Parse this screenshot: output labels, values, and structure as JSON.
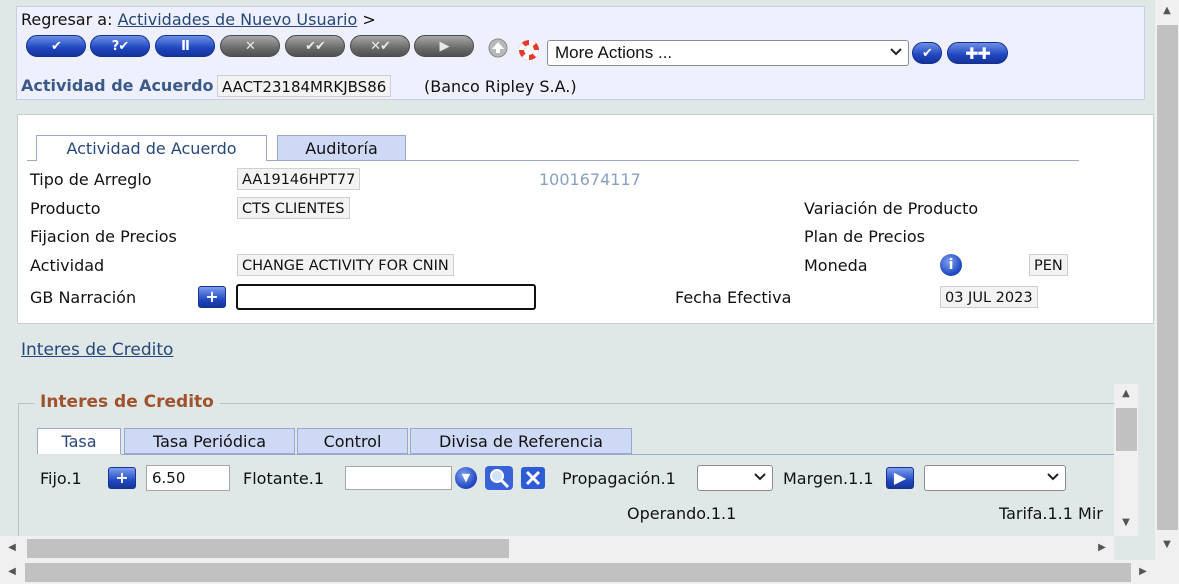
{
  "breadcrumb": {
    "prefix": "Regresar a:",
    "link": "Actividades de Nuevo Usuario",
    "separator": ">"
  },
  "toolbar": {
    "buttons": [
      {
        "name": "commit-button",
        "label": "✔"
      },
      {
        "name": "validate-button",
        "label": "?✔"
      },
      {
        "name": "hold-button",
        "label": "II"
      },
      {
        "name": "delete-button",
        "label": "✕"
      },
      {
        "name": "authorise-button",
        "label": "✔✔"
      },
      {
        "name": "reverse-button",
        "label": "✕✔"
      },
      {
        "name": "next-button",
        "label": "▶"
      }
    ],
    "more_actions": "More Actions ..."
  },
  "header": {
    "activity_label": "Actividad de Acuerdo",
    "activity_id": "AACT23184MRKJBS86",
    "company": "(Banco Ripley S.A.)"
  },
  "tabs": [
    {
      "label": "Actividad de Acuerdo",
      "active": true
    },
    {
      "label": "Auditoría",
      "active": false
    }
  ],
  "fields": {
    "tipo_arreglo_label": "Tipo de Arreglo",
    "tipo_arreglo_value": "AA19146HPT77",
    "customer_id": "1001674117",
    "producto_label": "Producto",
    "producto_value": "CTS CLIENTES",
    "variacion_label": "Variación de Producto",
    "fijacion_label": "Fijacion de Precios",
    "plan_label": "Plan de Precios",
    "actividad_label": "Actividad",
    "actividad_value": "CHANGE ACTIVITY FOR CNIN",
    "moneda_label": "Moneda",
    "moneda_value": "PEN",
    "narracion_label": "GB Narración",
    "narracion_value": "",
    "fecha_label": "Fecha Efectiva",
    "fecha_value": "03 JUL 2023"
  },
  "section_link": "Interes de Credito",
  "credit": {
    "legend": "Interes de Credito",
    "subtabs": [
      {
        "label": "Tasa",
        "active": true
      },
      {
        "label": "Tasa Periódica",
        "active": false
      },
      {
        "label": "Control",
        "active": false
      },
      {
        "label": "Divisa de Referencia",
        "active": false
      }
    ],
    "fijo_label": "Fijo.1",
    "fijo_value": "6.50",
    "flotante_label": "Flotante.1",
    "flotante_value": "",
    "propagacion_label": "Propagación.1",
    "propagacion_value": "",
    "margen_label": "Margen.1.1",
    "margen_value": "",
    "operando_label": "Operando.1.1",
    "tarifa_label": "Tarifa.1.1 Mir"
  },
  "colors": {
    "header_bg": "#eef1fd",
    "link": "#27467a",
    "legend": "#a0522d",
    "customer_id": "#8aa0c0"
  }
}
